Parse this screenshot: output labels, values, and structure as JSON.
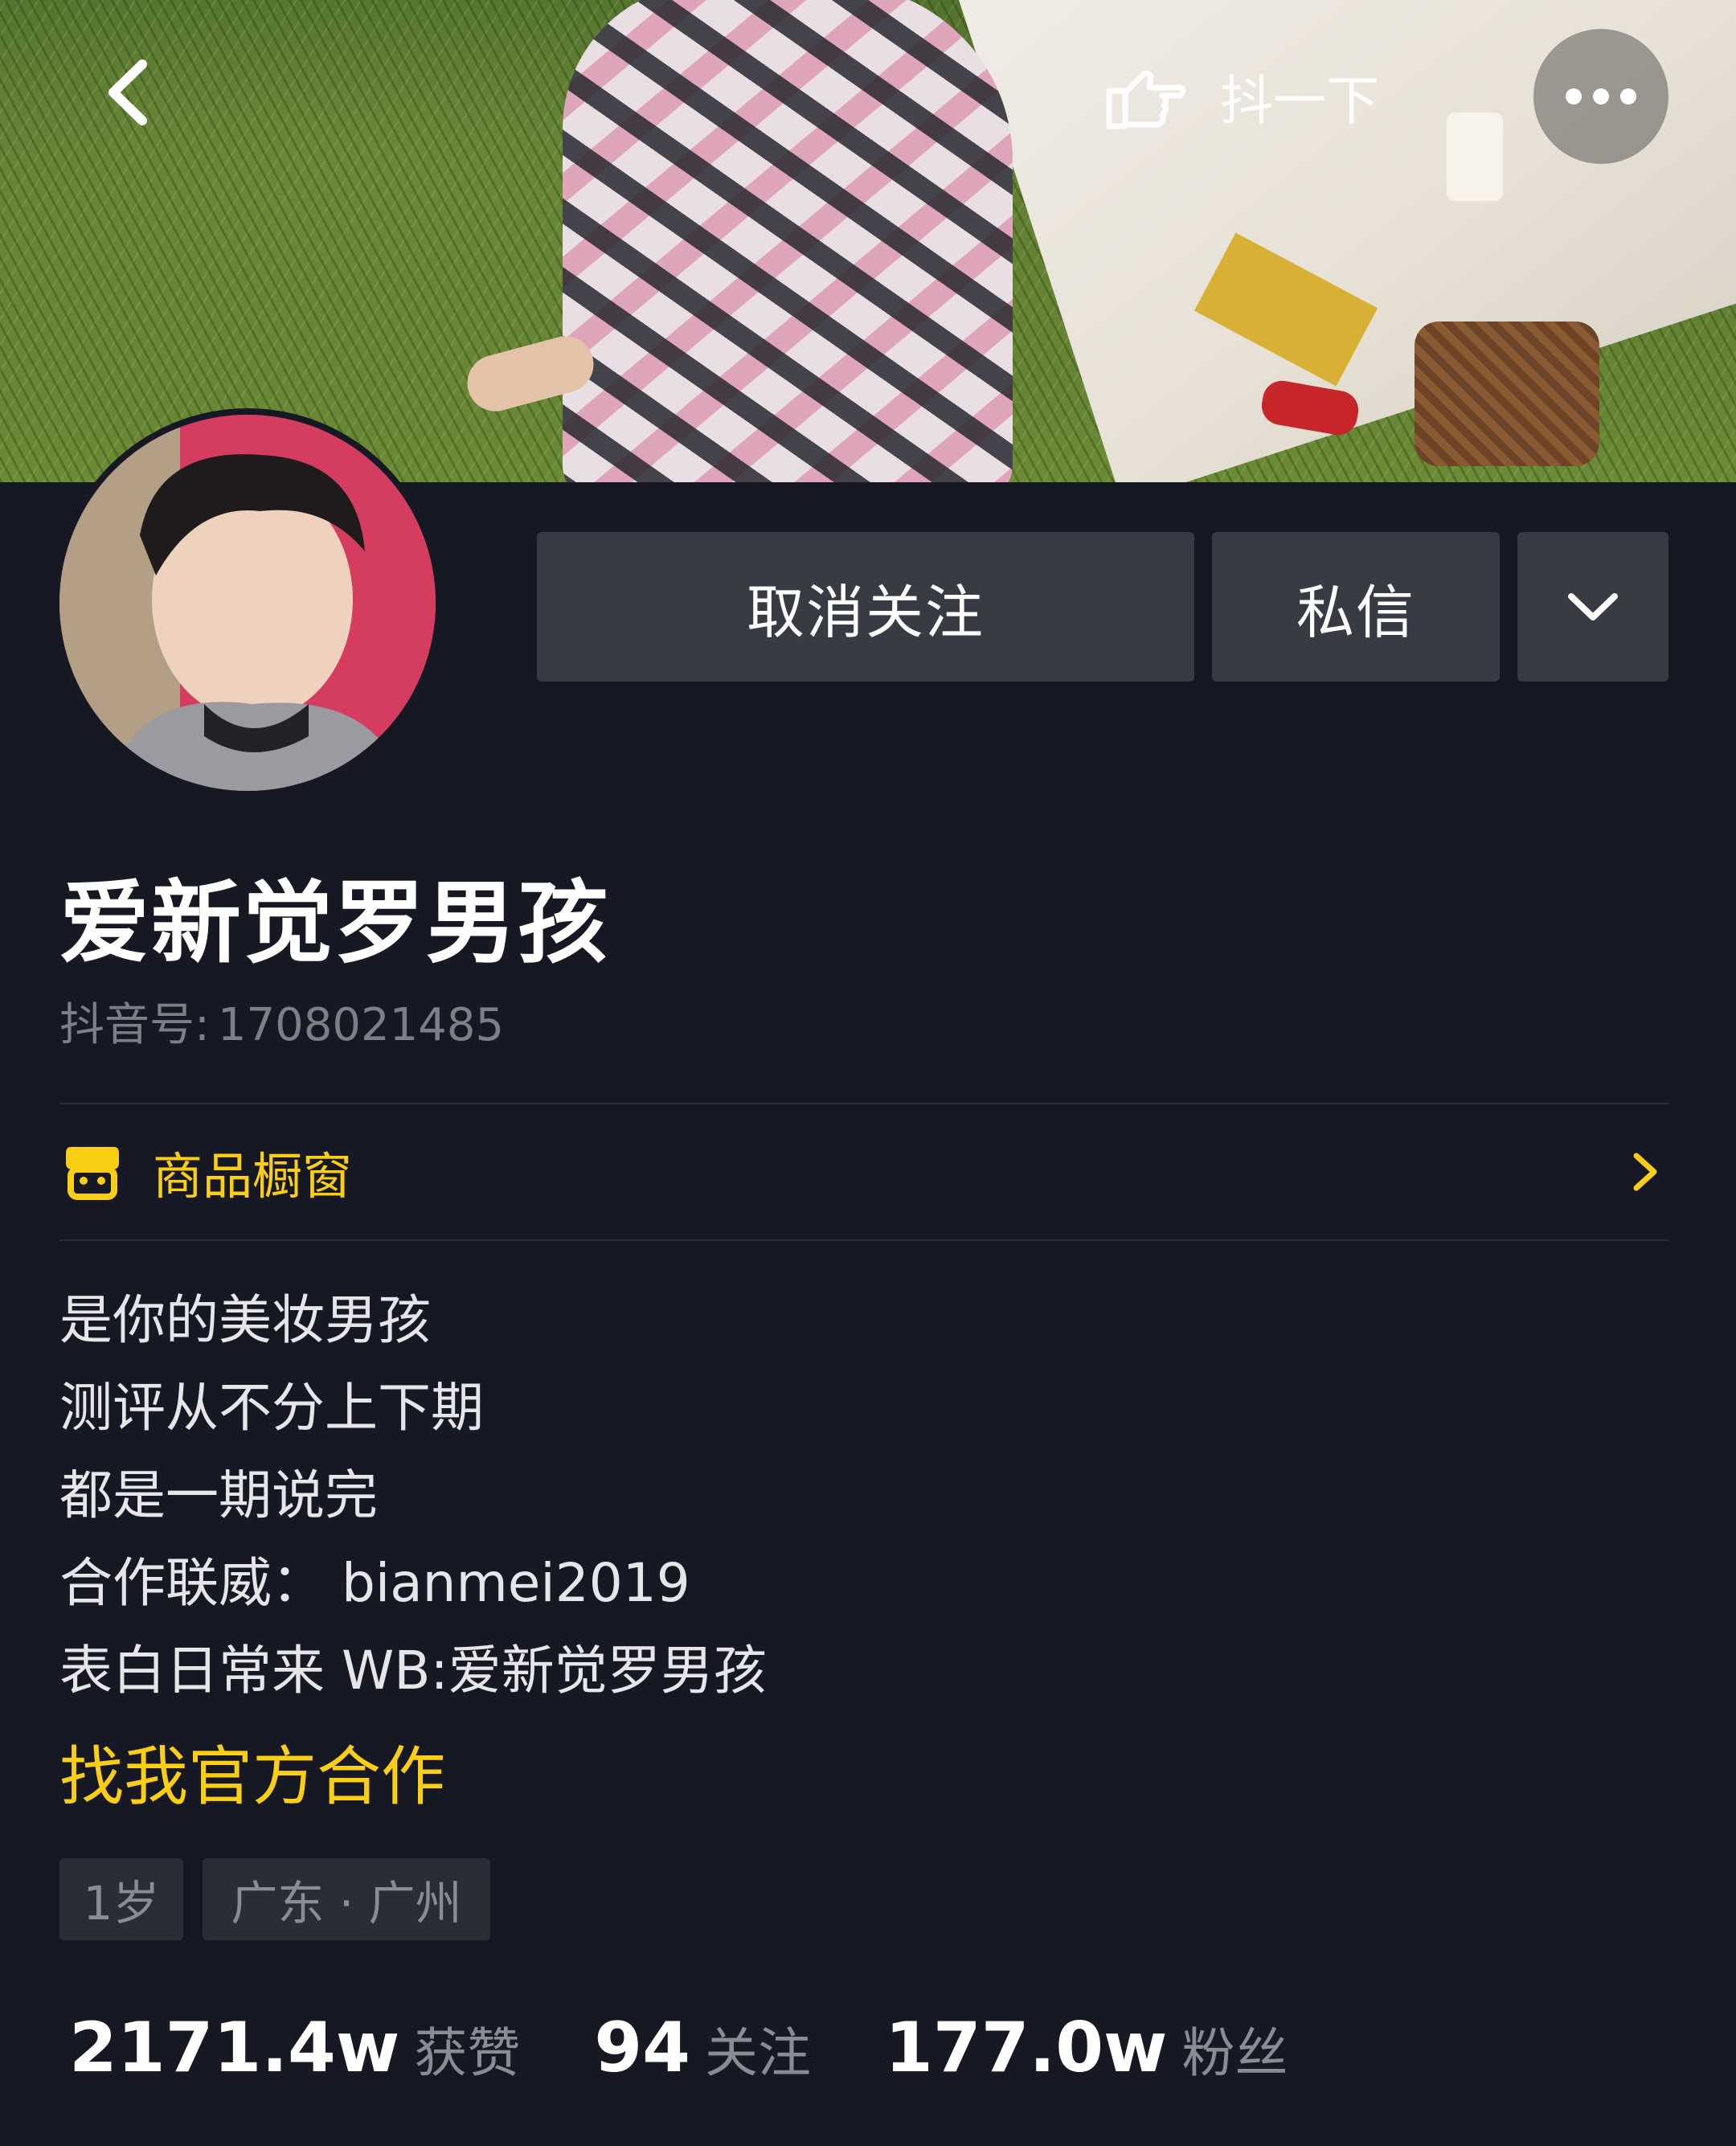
{
  "topbar": {
    "back_icon": "chevron-left-icon",
    "shake_icon": "pointing-hand-icon",
    "shake_label": "抖一下",
    "more_icon": "more-dots-icon"
  },
  "actions": {
    "unfollow_label": "取消关注",
    "message_label": "私信",
    "dropdown_icon": "chevron-down-icon"
  },
  "profile": {
    "nickname": "爱新觉罗男孩",
    "id_label": "抖音号:",
    "id_value": "1708021485"
  },
  "shop": {
    "icon": "shop-icon",
    "label": "商品橱窗",
    "chevron_icon": "chevron-right-icon"
  },
  "bio": {
    "lines": [
      "是你的美妆男孩",
      "测评从不分上下期",
      "都是一期说完",
      "合作联威： bianmei2019",
      "表白日常来 WB:爱新觉罗男孩"
    ],
    "coop_link": "找我官方合作"
  },
  "tags": [
    "1岁",
    "广东 · 广州"
  ],
  "stats": [
    {
      "value": "2171.4w",
      "label": "获赞"
    },
    {
      "value": "94",
      "label": "关注"
    },
    {
      "value": "177.0w",
      "label": "粉丝"
    }
  ],
  "colors": {
    "background": "#161823",
    "button": "#393b44",
    "accent_yellow": "#face15",
    "muted_text": "#8a8c93"
  }
}
